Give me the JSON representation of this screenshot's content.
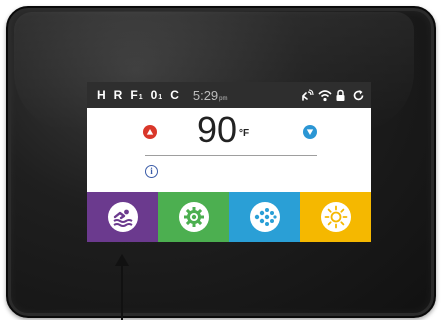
{
  "status_bar": {
    "modes": [
      {
        "letter": "H",
        "sub": ""
      },
      {
        "letter": "R",
        "sub": ""
      },
      {
        "letter": "F",
        "sub": "1"
      },
      {
        "letter": "0",
        "sub": "1"
      },
      {
        "letter": "C",
        "sub": ""
      }
    ],
    "time": "5:29",
    "ampm": "pm",
    "icons": [
      "spa-connect-icon",
      "wifi-icon",
      "lock-icon",
      "refresh-icon"
    ]
  },
  "temperature": {
    "value": "90",
    "unit": "°F"
  },
  "info_label": "i",
  "tiles": [
    {
      "name": "swim-tile",
      "icon": "swimmer-icon",
      "color": "#6b3a8e"
    },
    {
      "name": "pump-tile",
      "icon": "gear-icon",
      "color": "#4caf50"
    },
    {
      "name": "jets-tile",
      "icon": "jets-icon",
      "color": "#2a9fd6"
    },
    {
      "name": "light-tile",
      "icon": "sun-icon",
      "color": "#f5b800"
    }
  ],
  "colors": {
    "status_bar_bg": "#2e2e2e",
    "temp_up": "#d9372a",
    "temp_down": "#2b96d4",
    "info": "#3b5ca8"
  }
}
